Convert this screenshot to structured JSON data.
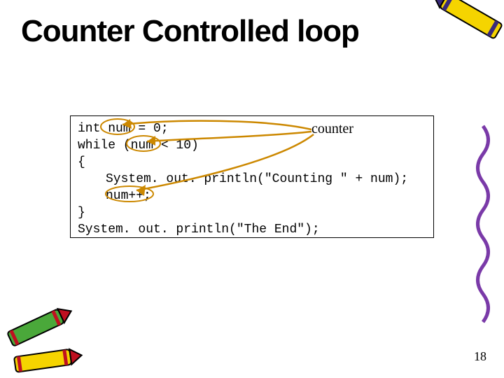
{
  "title": "Counter Controlled loop",
  "annotation": {
    "label": "counter"
  },
  "code": {
    "line1": "int num = 0;",
    "line2": "while (num < 10)",
    "line3": "{",
    "line4": "System. out. println(\"Counting \" + num);",
    "line5": "num++;",
    "line6": "}",
    "line7": "System. out. println(\"The End\");"
  },
  "page_number": "18"
}
